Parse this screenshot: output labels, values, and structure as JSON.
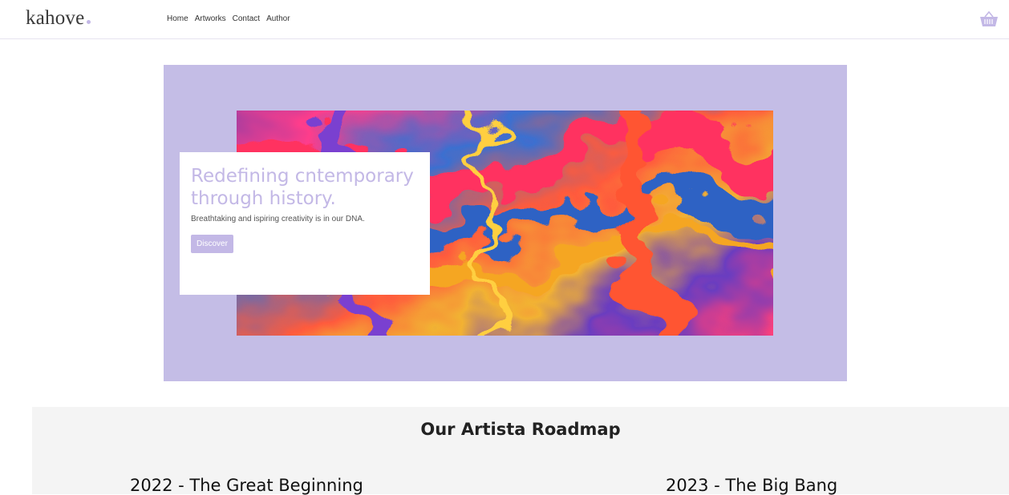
{
  "brand": {
    "name": "kahove",
    "dot_color": "#c3b8e6"
  },
  "nav": {
    "items": [
      {
        "label": "Home"
      },
      {
        "label": "Artworks"
      },
      {
        "label": "Contact"
      },
      {
        "label": "Author"
      }
    ],
    "cart_icon": "basket-icon"
  },
  "hero": {
    "bg_color": "#c4bde6",
    "title": "Redefining cntemporary through history.",
    "subtitle": "Breathtaking and ispiring creativity is in our DNA.",
    "button_label": "Discover",
    "accent": "#c3b8e6"
  },
  "roadmap": {
    "title": "Our Artista Roadmap",
    "milestones": [
      {
        "label": "2022 - The Great Beginning"
      },
      {
        "label": "2023 - The Big Bang"
      }
    ]
  }
}
